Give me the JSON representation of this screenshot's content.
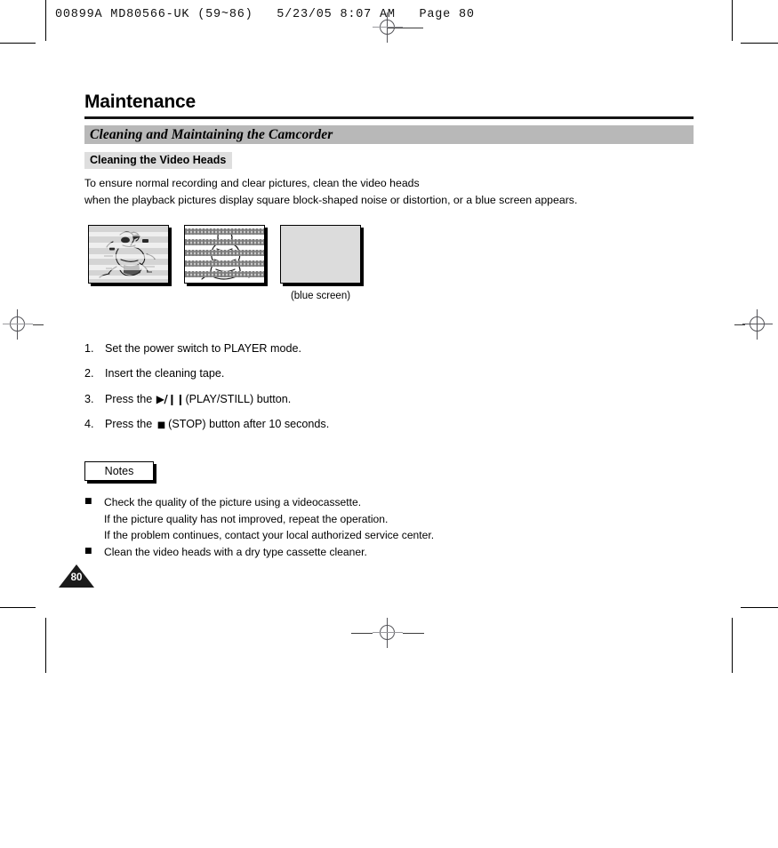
{
  "prepress": {
    "header_text": "00899A MD80566-UK (59~86)   5/23/05 8:07 AM   Page 80"
  },
  "document": {
    "title": "Maintenance",
    "section_bar": "Cleaning and Maintaining the Camcorder",
    "subsection": "Cleaning the Video Heads",
    "intro_line_1": "To ensure normal recording and clear pictures, clean the video heads",
    "intro_line_2": "when the playback pictures display square block-shaped noise or distortion, or a blue screen appears.",
    "page_number": "80"
  },
  "figures": {
    "caption_blue_screen": "(blue screen)",
    "fig1_name": "distorted-picture-illustration",
    "fig2_name": "block-noise-picture-illustration",
    "fig3_name": "blue-screen-illustration"
  },
  "steps": [
    {
      "number": "1.",
      "pre": "Set the power switch to PLAYER mode.",
      "glyph": "",
      "post": ""
    },
    {
      "number": "2.",
      "pre": "Insert the cleaning tape.",
      "glyph": "",
      "post": ""
    },
    {
      "number": "3.",
      "pre": "Press the ",
      "glyph": "▶/❙❙",
      "post": "(PLAY/STILL) button."
    },
    {
      "number": "4.",
      "pre": "Press the ",
      "glyph": "■",
      "post": "(STOP) button after 10 seconds."
    }
  ],
  "notes": {
    "label": "Notes",
    "bullet": "■",
    "items": [
      [
        "Check the quality of the picture using a videocassette.",
        "If the picture quality has not improved, repeat the operation.",
        "If the problem continues, contact your local authorized service center."
      ],
      [
        "Clean the video heads with a dry type cassette cleaner."
      ]
    ]
  },
  "colors": {
    "section_bar_gray": "#b8b8b8",
    "subsection_gray": "#dedede",
    "blue_screen_gray": "#dcdcdc",
    "rule_black": "#151515"
  }
}
